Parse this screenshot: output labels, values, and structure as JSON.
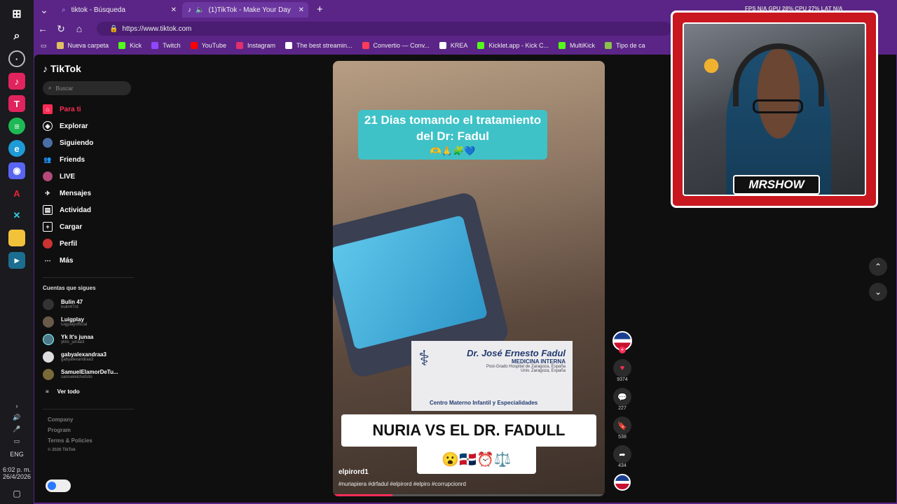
{
  "taskbar": {
    "time": "6:02 p. m.",
    "date": "26/4/2026",
    "lang": "ENG"
  },
  "tabs": [
    {
      "label": "tiktok - Búsqueda"
    },
    {
      "label": "(1)TikTok - Make Your Day"
    }
  ],
  "address": {
    "url": "https://www.tiktok.com"
  },
  "bookmarks": [
    {
      "label": "Nueva carpeta",
      "color": "#e0c060"
    },
    {
      "label": "Kick",
      "color": "#53fc18"
    },
    {
      "label": "Twitch",
      "color": "#9146ff"
    },
    {
      "label": "YouTube",
      "color": "#ff0000"
    },
    {
      "label": "Instagram",
      "color": "#e1306c"
    },
    {
      "label": "The best streamin...",
      "color": "#ffffff"
    },
    {
      "label": "Convertio — Conv...",
      "color": "#ff3b5c"
    },
    {
      "label": "KREA",
      "color": "#ffffff"
    },
    {
      "label": "Kicklet.app - Kick C...",
      "color": "#53fc18"
    },
    {
      "label": "MultiKick",
      "color": "#53fc18"
    },
    {
      "label": "Tipo de ca",
      "color": "#8bc34a"
    }
  ],
  "sidebar": {
    "brand": "TikTok",
    "search_placeholder": "Buscar",
    "menu": [
      {
        "label": "Para ti",
        "active": true
      },
      {
        "label": "Explorar"
      },
      {
        "label": "Siguiendo"
      },
      {
        "label": "Friends"
      },
      {
        "label": "LIVE"
      },
      {
        "label": "Mensajes"
      },
      {
        "label": "Actividad"
      },
      {
        "label": "Cargar"
      },
      {
        "label": "Perfil"
      },
      {
        "label": "Más"
      }
    ],
    "following_title": "Cuentas que sigues",
    "accounts": [
      {
        "name": "Bulin 47",
        "handle": "bulin47rd"
      },
      {
        "name": "Luigplay",
        "handle": "luigplayofficial"
      },
      {
        "name": "Yk It's junaa",
        "handle": "ykits_junaa3"
      },
      {
        "name": "gabyalexandraa3",
        "handle": "gabyalexandraa3"
      },
      {
        "name": "SamuelElamorDeTu...",
        "handle": "samuelelchefsito"
      }
    ],
    "see_all": "Ver todo",
    "footer": [
      "Company",
      "Program",
      "Terms & Policies",
      "© 2026 TikTok"
    ]
  },
  "video": {
    "banner": "21 Dias tomando el tratamiento del Dr: Fadul",
    "card_name": "Dr. José Ernesto Fadul",
    "card_spec": "MEDICINA INTERNA",
    "card_line1": "Post-Grado Hospital de Zaragoza, España",
    "card_line2": "Univ. Zaragoza, España",
    "card_center": "Centro Materno Infantil y Especialidades",
    "caption": "NURIA VS EL DR. FADULL",
    "emojis": "😮🇩🇴⏰⚖️",
    "username": "elpirord1",
    "hashtags": "#nuriapiera #drfadul #elpirord #elpiro #corrupcionrd"
  },
  "actions": {
    "likes": "9374",
    "comments": "227",
    "saves": "538",
    "shares": "434"
  },
  "webcam": {
    "label": "MRSHOW"
  },
  "hud": {
    "text": "FPS N/A   GPU 28%   CPU 27%   LAT N/A"
  }
}
